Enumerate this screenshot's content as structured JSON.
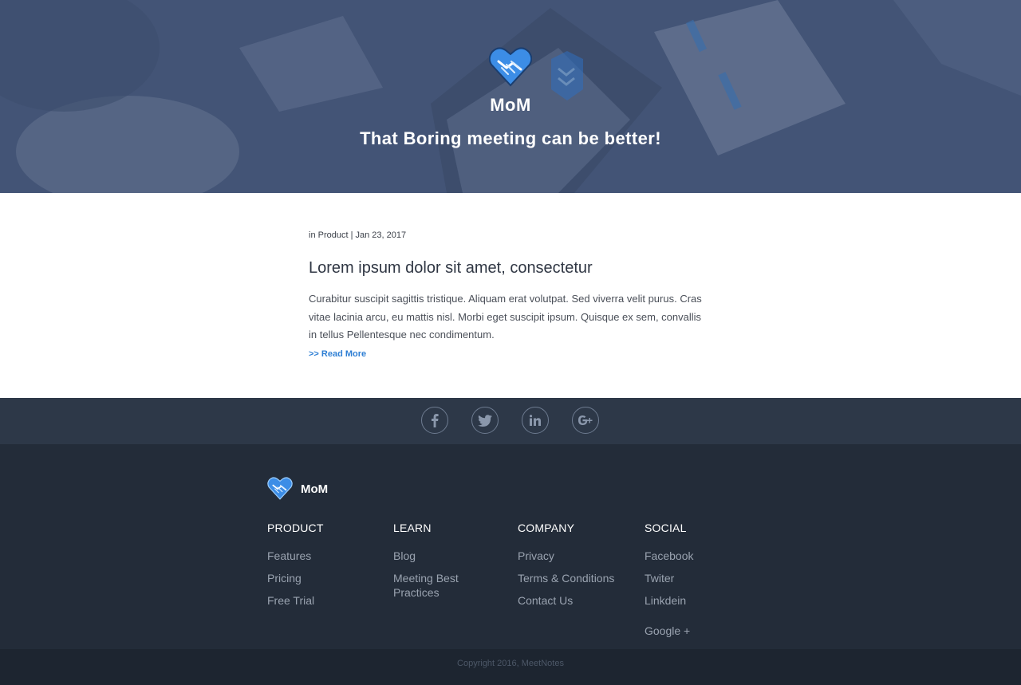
{
  "hero": {
    "brand": "MoM",
    "tagline": "That Boring meeting can be better!"
  },
  "article": {
    "meta_prefix": "in Product | Jan 23, 2017",
    "title": "Lorem ipsum dolor sit amet, consectetur",
    "excerpt": "Curabitur suscipit sagittis tristique. Aliquam erat volutpat. Sed viverra velit purus. Cras vitae lacinia arcu, eu mattis nisl. Morbi eget suscipit ipsum. Quisque ex sem, convallis in tellus Pellentesque nec condimentum.",
    "read_more": ">> Read More"
  },
  "social_icons": [
    "facebook-icon",
    "twitter-icon",
    "linkedin-icon",
    "google-plus-icon"
  ],
  "footer": {
    "brand": "MoM",
    "columns": [
      {
        "heading": "PRODUCT",
        "links": [
          "Features",
          "Pricing",
          "Free Trial"
        ]
      },
      {
        "heading": "LEARN",
        "links": [
          "Blog",
          "Meeting Best Practices"
        ]
      },
      {
        "heading": "COMPANY",
        "links": [
          "Privacy",
          "Terms & Conditions",
          "Contact Us"
        ]
      },
      {
        "heading": "SOCIAL",
        "links": [
          "Facebook",
          "Twiter",
          "Linkdein",
          "Google +"
        ]
      }
    ],
    "copyright": "Copyright 2016, MeetNotes"
  },
  "colors": {
    "accent": "#2f7fd4",
    "hero_bg": "#4b5c7d",
    "social_bar": "#2d3848",
    "footer_bg": "#232c39",
    "copy_bar": "#1d2530"
  }
}
